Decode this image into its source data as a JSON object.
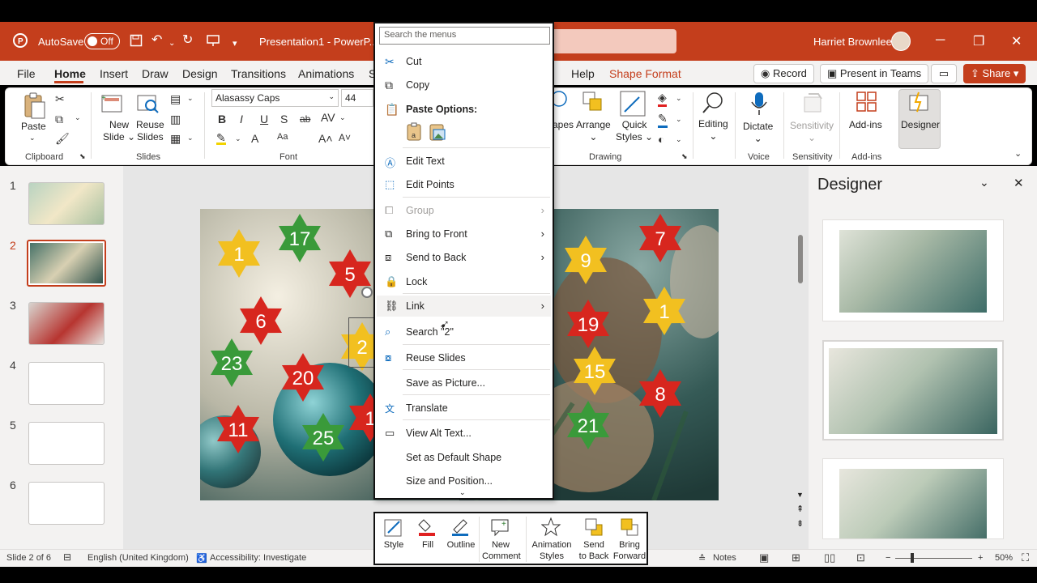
{
  "titlebar": {
    "autosave": "AutoSave",
    "autosave_state": "Off",
    "doc_title": "Presentation1 - PowerP...",
    "user": "Harriet Brownlee"
  },
  "tabs": [
    "File",
    "Home",
    "Insert",
    "Draw",
    "Design",
    "Transitions",
    "Animations",
    "S",
    "Help",
    "Shape Format"
  ],
  "header_buttons": {
    "record": "Record",
    "present": "Present in Teams",
    "share": "Share"
  },
  "ribbon": {
    "clipboard": {
      "paste": "Paste",
      "group": "Clipboard"
    },
    "slides": {
      "new_slide_1": "New",
      "new_slide_2": "Slide",
      "reuse_1": "Reuse",
      "reuse_2": "Slides",
      "group": "Slides"
    },
    "font": {
      "font_name": "Alasassy Caps",
      "font_size": "44",
      "group": "Font",
      "bold": "B",
      "italic": "I",
      "underline": "U",
      "shadow": "S",
      "strike": "ab"
    },
    "drawing": {
      "shapes": "apes",
      "arrange": "Arrange",
      "quick_styles_1": "Quick",
      "quick_styles_2": "Styles",
      "group": "Drawing"
    },
    "editing": {
      "label": "Editing"
    },
    "voice": {
      "dictate": "Dictate",
      "group": "Voice"
    },
    "sensitivity": {
      "label": "Sensitivity",
      "group": "Sensitivity"
    },
    "addins": {
      "label": "Add-ins",
      "group": "Add-ins"
    },
    "designer": {
      "label": "Designer"
    }
  },
  "thumbnails": [
    "1",
    "2",
    "3",
    "4",
    "5",
    "6"
  ],
  "slide_stars": {
    "left": [
      {
        "n": "1",
        "c": "yellow"
      },
      {
        "n": "17",
        "c": "green"
      },
      {
        "n": "5",
        "c": "red"
      },
      {
        "n": "6",
        "c": "red"
      },
      {
        "n": "23",
        "c": "green"
      },
      {
        "n": "20",
        "c": "red"
      },
      {
        "n": "11",
        "c": "red"
      },
      {
        "n": "25",
        "c": "green"
      },
      {
        "n": "2",
        "c": "yellow"
      },
      {
        "n": "1",
        "c": "red"
      }
    ],
    "right": [
      {
        "n": "7",
        "c": "red"
      },
      {
        "n": "9",
        "c": "yellow"
      },
      {
        "n": "1",
        "c": "yellow"
      },
      {
        "n": "19",
        "c": "red"
      },
      {
        "n": "15",
        "c": "yellow"
      },
      {
        "n": "8",
        "c": "red"
      },
      {
        "n": "21",
        "c": "green"
      }
    ]
  },
  "designer": {
    "title": "Designer"
  },
  "context_menu": {
    "search_placeholder": "Search the menus",
    "items": {
      "cut": "Cut",
      "copy": "Copy",
      "paste_options": "Paste Options:",
      "edit_text": "Edit Text",
      "edit_points": "Edit Points",
      "group": "Group",
      "bring_to_front": "Bring to Front",
      "send_to_back": "Send to Back",
      "lock": "Lock",
      "link": "Link",
      "search": "Search \"2\"",
      "reuse_slides": "Reuse Slides",
      "save_as_picture": "Save as Picture...",
      "translate": "Translate",
      "view_alt_text": "View Alt Text...",
      "set_default_shape": "Set as Default Shape",
      "size_position": "Size and Position..."
    }
  },
  "mini_toolbar": {
    "style": "Style",
    "fill": "Fill",
    "outline": "Outline",
    "new_comment_1": "New",
    "new_comment_2": "Comment",
    "animation_styles_1": "Animation",
    "animation_styles_2": "Styles",
    "send_to_back_1": "Send",
    "send_to_back_2": "to Back",
    "bring_forward_1": "Bring",
    "bring_forward_2": "Forward"
  },
  "statusbar": {
    "slide": "Slide 2 of 6",
    "language": "English (United Kingdom)",
    "accessibility": "Accessibility: Investigate",
    "notes": "Notes",
    "zoom": "50%"
  },
  "colors": {
    "accent": "#c43e1c",
    "star_red": "#d7261e",
    "star_green": "#3a9a3a",
    "star_yellow": "#f2c020"
  }
}
